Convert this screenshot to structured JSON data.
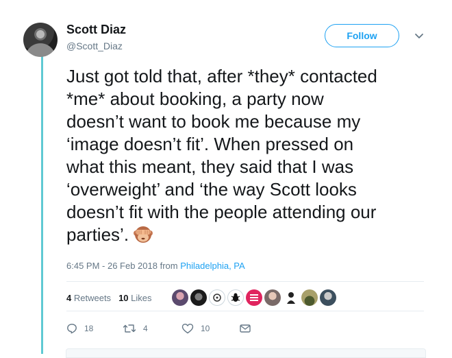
{
  "user": {
    "name": "Scott Diaz",
    "handle": "@Scott_Diaz"
  },
  "follow_label": "Follow",
  "tweet": {
    "lines": [
      "Just got told that, after *they* contacted",
      "*me* about booking, a party now",
      "doesn’t want to book me because my",
      "‘image doesn’t fit’. When pressed on",
      "what this meant, they said that I was",
      "‘overweight’ and ‘the way Scott looks",
      "doesn’t fit with the people attending our",
      "parties’."
    ],
    "emoji": "see-no-evil-monkey"
  },
  "meta": {
    "timestamp": "6:45 PM - 26 Feb 2018",
    "from_label": "from",
    "location": "Philadelphia, PA"
  },
  "stats": {
    "retweets_count": "4",
    "retweets_label": "Retweets",
    "likes_count": "10",
    "likes_label": "Likes"
  },
  "likers": [
    {
      "icon": "liker-avatar-1",
      "color": "#5b4a6e"
    },
    {
      "icon": "liker-avatar-2",
      "color": "#1b1b1b"
    },
    {
      "icon": "liker-avatar-3",
      "color": "#ffffff"
    },
    {
      "icon": "liker-avatar-4",
      "color": "#ffffff"
    },
    {
      "icon": "liker-avatar-5",
      "color": "#e0245e"
    },
    {
      "icon": "liker-avatar-6",
      "color": "#7a6a68"
    },
    {
      "icon": "liker-avatar-7",
      "color": "#ffffff"
    },
    {
      "icon": "liker-avatar-8",
      "color": "#8a8a4a"
    },
    {
      "icon": "liker-avatar-9",
      "color": "#3c4f5e"
    }
  ],
  "actions": {
    "reply_count": "18",
    "retweet_count": "4",
    "like_count": "10"
  },
  "colors": {
    "accent": "#1da1f2",
    "thread_line": "#5fc9d3",
    "secondary_text": "#657786"
  }
}
